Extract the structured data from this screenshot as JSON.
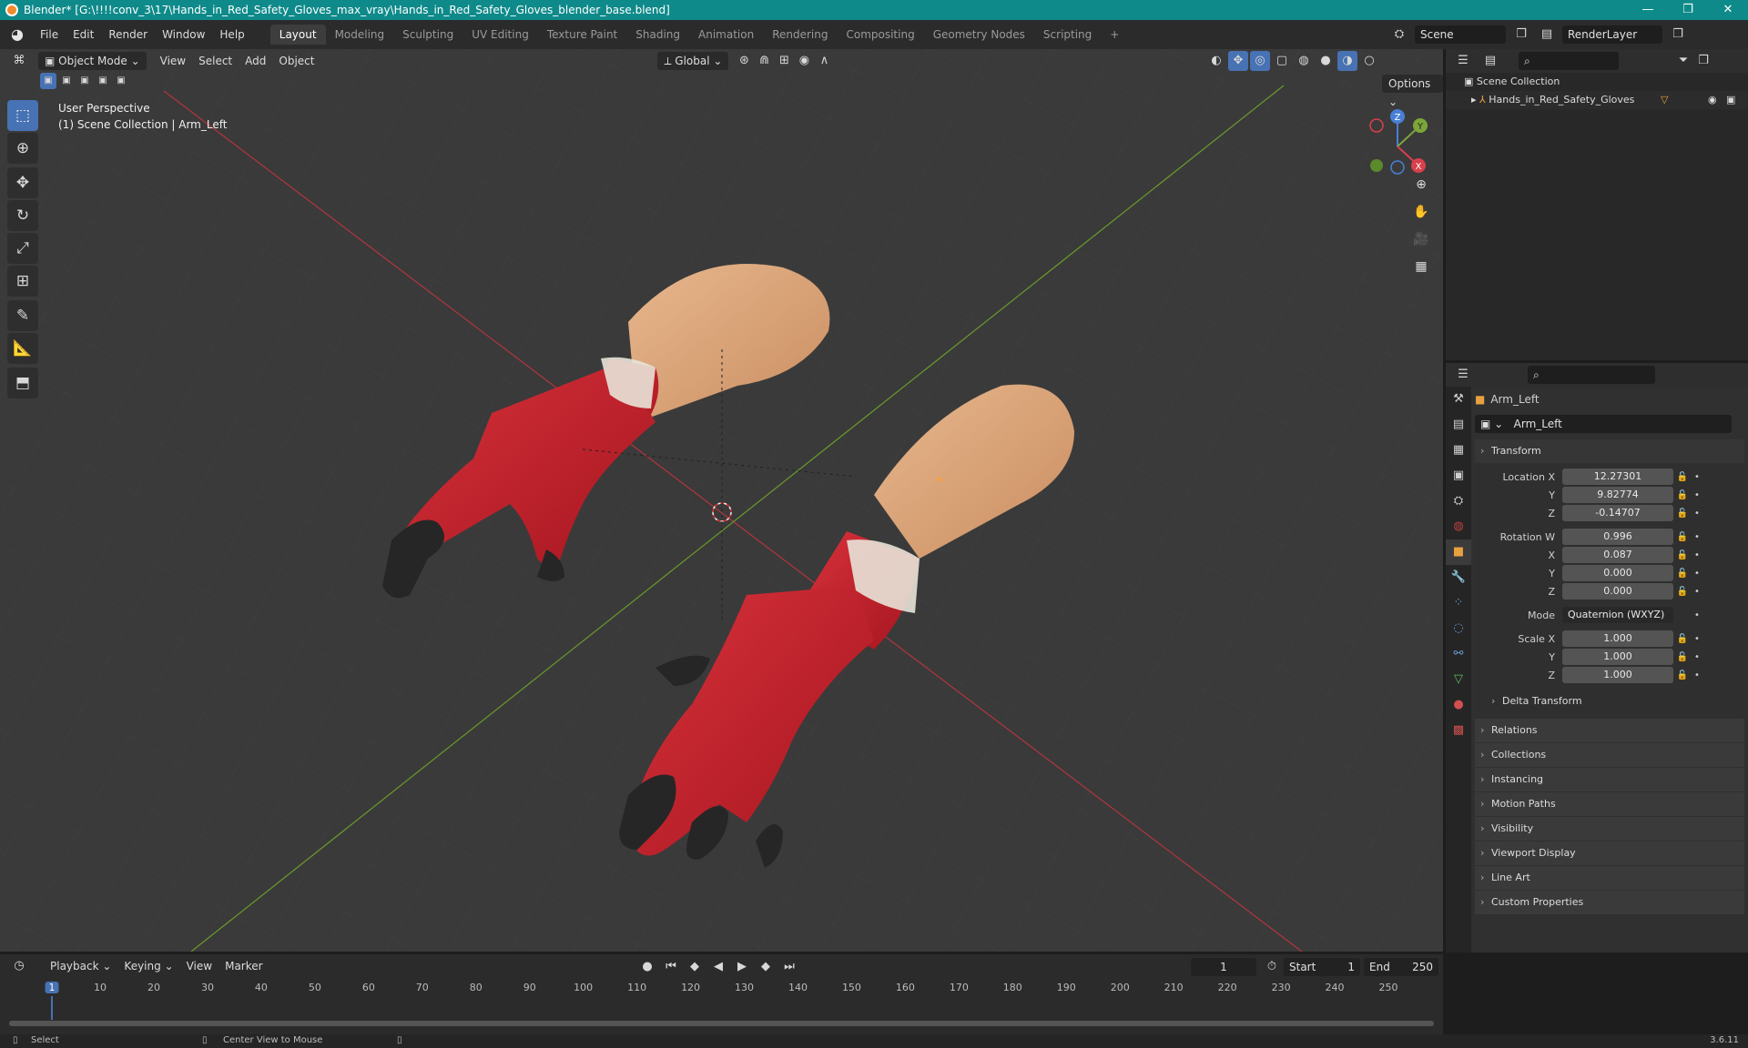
{
  "window": {
    "title": "Blender* [G:\\!!!!conv_3\\17\\Hands_in_Red_Safety_Gloves_max_vray\\Hands_in_Red_Safety_Gloves_blender_base.blend]",
    "controls": [
      "—",
      "❐",
      "✕"
    ]
  },
  "menus": [
    "File",
    "Edit",
    "Render",
    "Window",
    "Help"
  ],
  "workspaces": [
    "Layout",
    "Modeling",
    "Sculpting",
    "UV Editing",
    "Texture Paint",
    "Shading",
    "Animation",
    "Rendering",
    "Compositing",
    "Geometry Nodes",
    "Scripting",
    "+"
  ],
  "active_workspace": "Layout",
  "scene": {
    "name": "Scene",
    "render_layer": "RenderLayer"
  },
  "viewport": {
    "mode": "Object Mode",
    "menus": [
      "View",
      "Select",
      "Add",
      "Object"
    ],
    "transform_orientation": "Global",
    "options_label": "Options",
    "info_line1": "User Perspective",
    "info_line2": "(1) Scene Collection | Arm_Left",
    "gizmo_axes": {
      "z": "Z",
      "y": "Y",
      "x": "X"
    },
    "tools": [
      "select",
      "cursor",
      "move",
      "rotate",
      "scale",
      "transform",
      "annotate",
      "measure",
      "add-cube"
    ]
  },
  "outliner": {
    "root": "Scene Collection",
    "items": [
      {
        "label": "Hands_in_Red_Safety_Gloves"
      }
    ]
  },
  "properties": {
    "object_name": "Arm_Left",
    "data_name": "Arm_Left",
    "transform_title": "Transform",
    "location": {
      "label": "Location X",
      "x": "12.27301",
      "y": "9.82774",
      "z": "-0.14707"
    },
    "rotation": {
      "label": "Rotation W",
      "w": "0.996",
      "x": "0.087",
      "y": "0.000",
      "z": "0.000"
    },
    "mode": {
      "label": "Mode",
      "value": "Quaternion (WXYZ)"
    },
    "scale": {
      "label": "Scale X",
      "x": "1.000",
      "y": "1.000",
      "z": "1.000"
    },
    "axis_labels": {
      "y": "Y",
      "z": "Z",
      "x": "X"
    },
    "delta": "Delta Transform",
    "panels": [
      "Relations",
      "Collections",
      "Instancing",
      "Motion Paths",
      "Visibility",
      "Viewport Display",
      "Line Art",
      "Custom Properties"
    ]
  },
  "timeline": {
    "menus": [
      "Playback",
      "Keying",
      "View",
      "Marker"
    ],
    "current_frame": "1",
    "start_label": "Start",
    "start": "1",
    "end_label": "End",
    "end": "250",
    "ruler": [
      "1",
      "10",
      "20",
      "30",
      "40",
      "50",
      "60",
      "70",
      "80",
      "90",
      "100",
      "110",
      "120",
      "130",
      "140",
      "150",
      "160",
      "170",
      "180",
      "190",
      "200",
      "210",
      "220",
      "230",
      "240",
      "250"
    ]
  },
  "statusbar": {
    "select": "Select",
    "center_view": "Center View to Mouse",
    "version": "3.6.11"
  },
  "colors": {
    "accent": "#4772b3",
    "titlebar": "#0f8a8a",
    "glove_red": "#c8202c",
    "skin": "#d9a072"
  }
}
